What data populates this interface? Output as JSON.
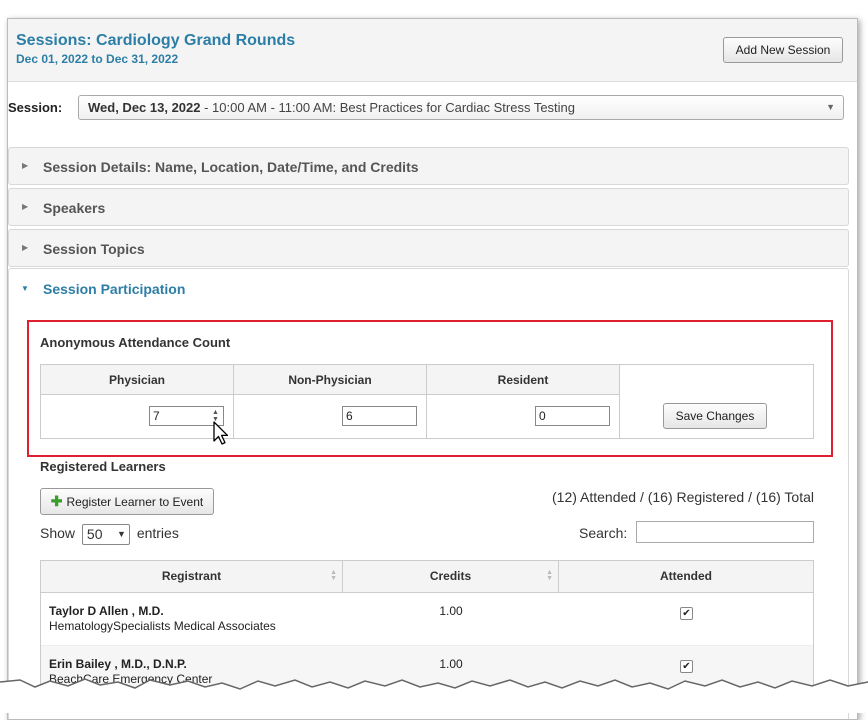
{
  "header": {
    "title": "Sessions: Cardiology Grand Rounds",
    "date_range": "Dec 01, 2022 to Dec 31, 2022",
    "add_session_label": "Add New Session"
  },
  "session_select": {
    "label": "Session:",
    "value_bold": "Wed, Dec 13, 2022",
    "value_rest": " - 10:00 AM - 11:00 AM: Best Practices for Cardiac Stress Testing"
  },
  "accordion": [
    {
      "label": "Session Details: Name, Location, Date/Time, and Credits"
    },
    {
      "label": "Speakers"
    },
    {
      "label": "Session Topics"
    },
    {
      "label": "Session Participation"
    }
  ],
  "anonymous": {
    "title": "Anonymous Attendance Count",
    "columns": [
      "Physician",
      "Non-Physician",
      "Resident"
    ],
    "values": [
      "7",
      "6",
      "0"
    ],
    "save_label": "Save Changes"
  },
  "learners": {
    "title": "Registered Learners",
    "register_label": "Register Learner to Event",
    "totals": "(12) Attended / (16) Registered / (16) Total",
    "show_label": "Show",
    "entries_value": "50",
    "entries_label": "entries",
    "search_label": "Search:",
    "search_value": "",
    "headers": [
      "Registrant",
      "Credits",
      "Attended"
    ],
    "rows": [
      {
        "name": "Taylor D Allen , M.D.",
        "org": "HematologySpecialists Medical Associates",
        "credits": "1.00",
        "attended": true
      },
      {
        "name": "Erin Bailey , M.D., D.N.P.",
        "org": "BeachCare Emergency Center",
        "credits": "1.00",
        "attended": true
      }
    ]
  },
  "colors": {
    "accent": "#2c7ea6",
    "highlight": "#e0202e",
    "add_icon": "#3a9e2a"
  }
}
